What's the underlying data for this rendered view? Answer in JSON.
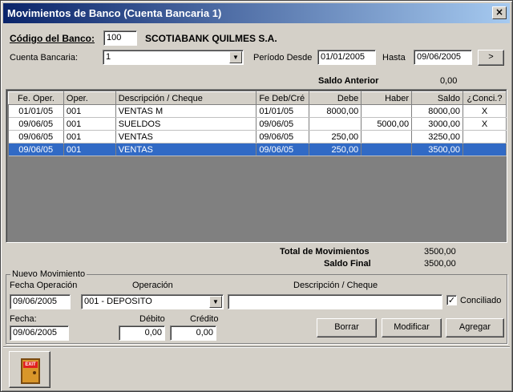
{
  "window": {
    "title": "Movimientos de Banco (Cuenta Bancaria 1)",
    "close_glyph": "×"
  },
  "header": {
    "codigo_label": "Código del Banco:",
    "codigo_value": "100",
    "bank_name": "SCOTIABANK QUILMES S.A.",
    "cuenta_label": "Cuenta Bancaria:",
    "cuenta_value": "1",
    "periodo_label": "Período Desde",
    "periodo_desde": "01/01/2005",
    "hasta_label": "Hasta",
    "hasta_value": "09/06/2005",
    "go_label": ">"
  },
  "saldo_anterior": {
    "label": "Saldo Anterior",
    "value": "0,00"
  },
  "grid": {
    "columns": [
      "Fe. Oper.",
      "Oper.",
      "Descripción / Cheque",
      "Fe Deb/Cré",
      "Debe",
      "Haber",
      "Saldo",
      "¿Conci.?"
    ],
    "rows": [
      {
        "fecha": "01/01/05",
        "oper": "001",
        "desc": "VENTAS M",
        "fe_deb": "01/01/05",
        "debe": "8000,00",
        "haber": "",
        "saldo": "8000,00",
        "conci": "X"
      },
      {
        "fecha": "09/06/05",
        "oper": "001",
        "desc": "SUELDOS",
        "fe_deb": "09/06/05",
        "debe": "",
        "haber": "5000,00",
        "saldo": "3000,00",
        "conci": "X"
      },
      {
        "fecha": "09/06/05",
        "oper": "001",
        "desc": "VENTAS",
        "fe_deb": "09/06/05",
        "debe": "250,00",
        "haber": "",
        "saldo": "3250,00",
        "conci": ""
      },
      {
        "fecha": "09/06/05",
        "oper": "001",
        "desc": "VENTAS",
        "fe_deb": "09/06/05",
        "debe": "250,00",
        "haber": "",
        "saldo": "3500,00",
        "conci": ""
      }
    ]
  },
  "totals": {
    "total_label": "Total de Movimientos",
    "total_value": "3500,00",
    "final_label": "Saldo Final",
    "final_value": "3500,00"
  },
  "nuevo": {
    "group_label": "Nuevo Movimiento",
    "fecha_op_label": "Fecha Operación",
    "fecha_op_value": "09/06/2005",
    "operacion_label": "Operación",
    "operacion_value": "001 - DEPOSITO",
    "desc_label": "Descripción / Cheque",
    "desc_value": "",
    "conciliado_label": "Conciliado",
    "conciliado_mark": "✓",
    "fecha_label": "Fecha:",
    "fecha_value": "09/06/2005",
    "debito_label": "Débito",
    "debito_value": "0,00",
    "credito_label": "Crédito",
    "credito_value": "0,00",
    "borrar_label": "Borrar",
    "modificar_label": "Modificar",
    "agregar_label": "Agregar"
  },
  "exit": {
    "sign": "EXIT",
    "icon": "exit-door-icon"
  },
  "icons": {
    "combo_arrow": "▼"
  }
}
